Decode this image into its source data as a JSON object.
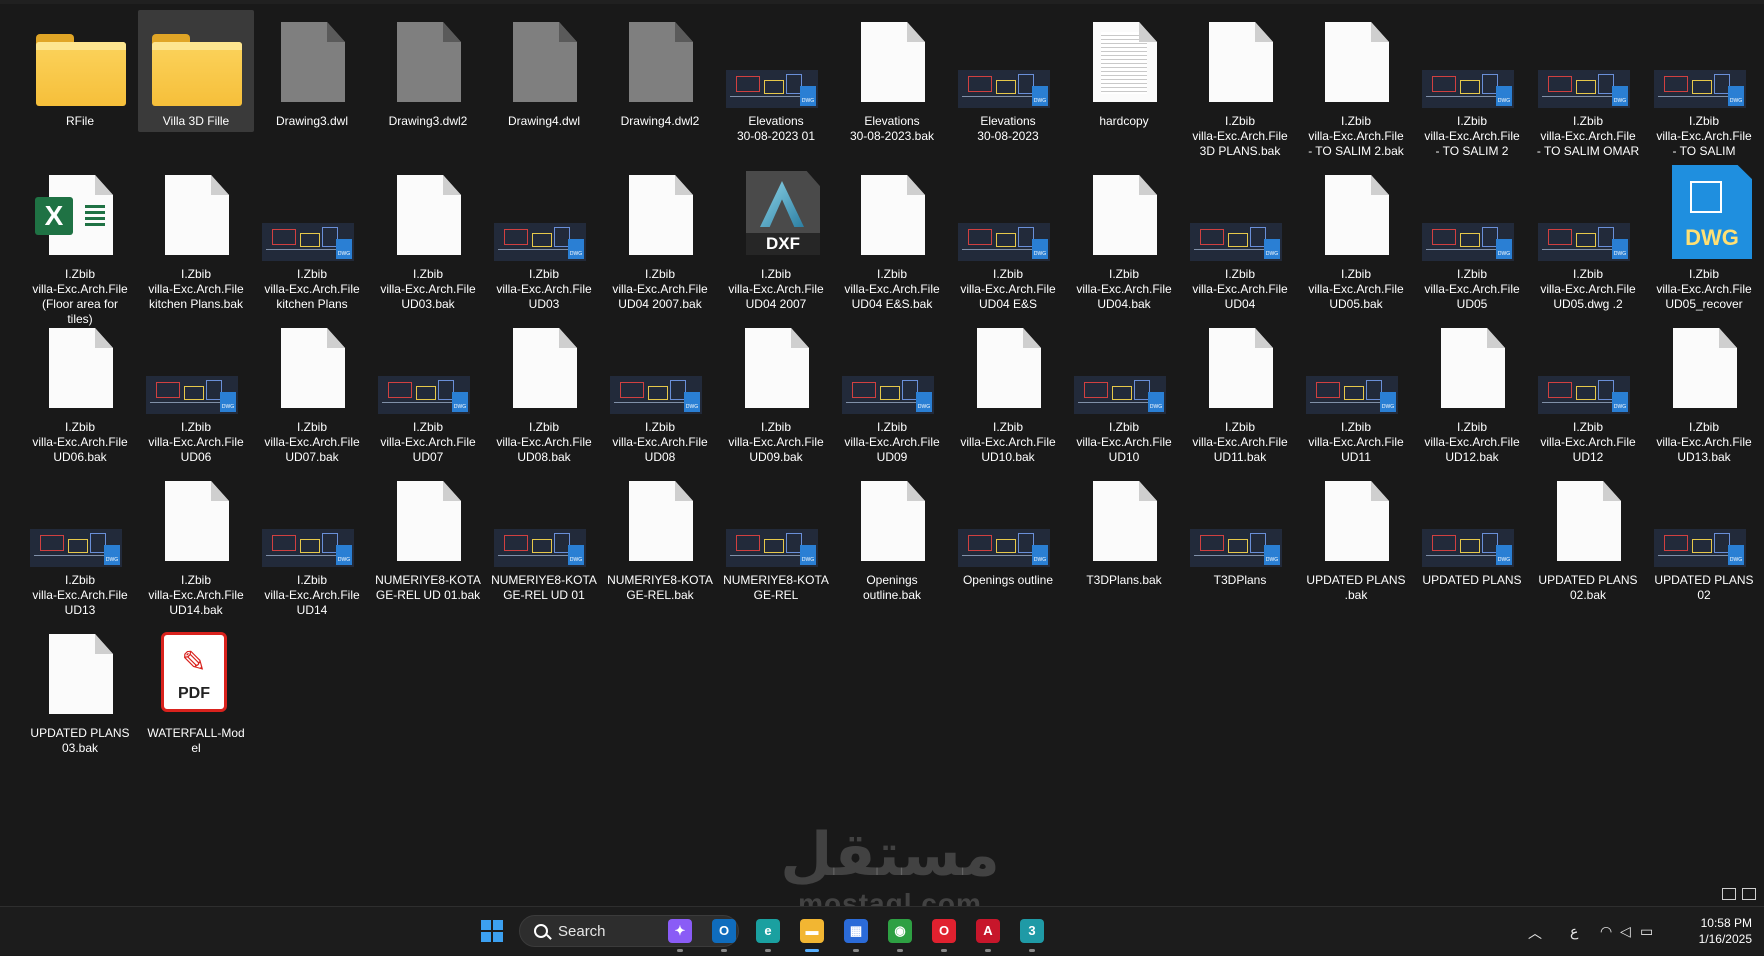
{
  "files": [
    {
      "name": "RFile",
      "icon": "folder-icon",
      "kind": "folder"
    },
    {
      "name": "Villa 3D Fille",
      "icon": "folder-icon",
      "kind": "folder",
      "selected": true
    },
    {
      "name": "Drawing3.dwl",
      "icon": "gray-file-icon",
      "kind": "gray"
    },
    {
      "name": "Drawing3.dwl2",
      "icon": "gray-file-icon",
      "kind": "gray"
    },
    {
      "name": "Drawing4.dwl",
      "icon": "gray-file-icon",
      "kind": "gray"
    },
    {
      "name": "Drawing4.dwl2",
      "icon": "gray-file-icon",
      "kind": "gray"
    },
    {
      "name": "Elevations\n30-08-2023 01",
      "icon": "dwg-preview-icon",
      "kind": "cad"
    },
    {
      "name": "Elevations\n30-08-2023.bak",
      "icon": "blank-file-icon",
      "kind": "blank"
    },
    {
      "name": "Elevations\n30-08-2023",
      "icon": "dwg-preview-icon",
      "kind": "cad"
    },
    {
      "name": "hardcopy",
      "icon": "text-file-icon",
      "kind": "text"
    },
    {
      "name": "I.Zbib\nvilla-Exc.Arch.File\n3D PLANS.bak",
      "icon": "blank-file-icon",
      "kind": "blank"
    },
    {
      "name": "I.Zbib\nvilla-Exc.Arch.File\n- TO SALIM 2.bak",
      "icon": "blank-file-icon",
      "kind": "blank"
    },
    {
      "name": "I.Zbib\nvilla-Exc.Arch.File\n- TO SALIM 2",
      "icon": "dwg-preview-icon",
      "kind": "cad"
    },
    {
      "name": "I.Zbib\nvilla-Exc.Arch.File\n- TO SALIM OMAR",
      "icon": "dwg-preview-icon",
      "kind": "cad"
    },
    {
      "name": "I.Zbib\nvilla-Exc.Arch.File\n- TO SALIM",
      "icon": "dwg-preview-icon",
      "kind": "cad"
    },
    {
      "name": "I.Zbib\nvilla-Exc.Arch.File\n(Floor area for\ntiles)",
      "icon": "excel-file-icon",
      "kind": "excel"
    },
    {
      "name": "I.Zbib\nvilla-Exc.Arch.File\nkitchen Plans.bak",
      "icon": "blank-file-icon",
      "kind": "blank"
    },
    {
      "name": "I.Zbib\nvilla-Exc.Arch.File\nkitchen Plans",
      "icon": "dwg-preview-icon",
      "kind": "cad"
    },
    {
      "name": "I.Zbib\nvilla-Exc.Arch.File\nUD03.bak",
      "icon": "blank-file-icon",
      "kind": "blank"
    },
    {
      "name": "I.Zbib\nvilla-Exc.Arch.File\nUD03",
      "icon": "dwg-preview-icon",
      "kind": "cad"
    },
    {
      "name": "I.Zbib\nvilla-Exc.Arch.File\nUD04 2007.bak",
      "icon": "blank-file-icon",
      "kind": "blank"
    },
    {
      "name": "I.Zbib\nvilla-Exc.Arch.File\nUD04 2007",
      "icon": "dxf-file-icon",
      "kind": "dxf",
      "badge": "DXF"
    },
    {
      "name": "I.Zbib\nvilla-Exc.Arch.File\nUD04 E&S.bak",
      "icon": "blank-file-icon",
      "kind": "blank"
    },
    {
      "name": "I.Zbib\nvilla-Exc.Arch.File\nUD04 E&S",
      "icon": "dwg-preview-icon",
      "kind": "cad"
    },
    {
      "name": "I.Zbib\nvilla-Exc.Arch.File\nUD04.bak",
      "icon": "blank-file-icon",
      "kind": "blank"
    },
    {
      "name": "I.Zbib\nvilla-Exc.Arch.File\nUD04",
      "icon": "dwg-preview-icon",
      "kind": "cad"
    },
    {
      "name": "I.Zbib\nvilla-Exc.Arch.File\nUD05.bak",
      "icon": "blank-file-icon",
      "kind": "blank"
    },
    {
      "name": "I.Zbib\nvilla-Exc.Arch.File\nUD05",
      "icon": "dwg-preview-icon",
      "kind": "cad"
    },
    {
      "name": "I.Zbib\nvilla-Exc.Arch.File\nUD05.dwg .2",
      "icon": "dwg-preview-icon",
      "kind": "cad"
    },
    {
      "name": "I.Zbib\nvilla-Exc.Arch.File\nUD05_recover",
      "icon": "dwg-file-icon",
      "kind": "dwg",
      "badge": "DWG"
    },
    {
      "name": "I.Zbib\nvilla-Exc.Arch.File\nUD06.bak",
      "icon": "blank-file-icon",
      "kind": "blank"
    },
    {
      "name": "I.Zbib\nvilla-Exc.Arch.File\nUD06",
      "icon": "dwg-preview-icon",
      "kind": "cad"
    },
    {
      "name": "I.Zbib\nvilla-Exc.Arch.File\nUD07.bak",
      "icon": "blank-file-icon",
      "kind": "blank"
    },
    {
      "name": "I.Zbib\nvilla-Exc.Arch.File\nUD07",
      "icon": "dwg-preview-icon",
      "kind": "cad"
    },
    {
      "name": "I.Zbib\nvilla-Exc.Arch.File\nUD08.bak",
      "icon": "blank-file-icon",
      "kind": "blank"
    },
    {
      "name": "I.Zbib\nvilla-Exc.Arch.File\nUD08",
      "icon": "dwg-preview-icon",
      "kind": "cad"
    },
    {
      "name": "I.Zbib\nvilla-Exc.Arch.File\nUD09.bak",
      "icon": "blank-file-icon",
      "kind": "blank"
    },
    {
      "name": "I.Zbib\nvilla-Exc.Arch.File\nUD09",
      "icon": "dwg-preview-icon",
      "kind": "cad"
    },
    {
      "name": "I.Zbib\nvilla-Exc.Arch.File\nUD10.bak",
      "icon": "blank-file-icon",
      "kind": "blank"
    },
    {
      "name": "I.Zbib\nvilla-Exc.Arch.File\nUD10",
      "icon": "dwg-preview-icon",
      "kind": "cad"
    },
    {
      "name": "I.Zbib\nvilla-Exc.Arch.File\nUD11.bak",
      "icon": "blank-file-icon",
      "kind": "blank"
    },
    {
      "name": "I.Zbib\nvilla-Exc.Arch.File\nUD11",
      "icon": "dwg-preview-icon",
      "kind": "cad"
    },
    {
      "name": "I.Zbib\nvilla-Exc.Arch.File\nUD12.bak",
      "icon": "blank-file-icon",
      "kind": "blank"
    },
    {
      "name": "I.Zbib\nvilla-Exc.Arch.File\nUD12",
      "icon": "dwg-preview-icon",
      "kind": "cad"
    },
    {
      "name": "I.Zbib\nvilla-Exc.Arch.File\nUD13.bak",
      "icon": "blank-file-icon",
      "kind": "blank"
    },
    {
      "name": "I.Zbib\nvilla-Exc.Arch.File\nUD13",
      "icon": "dwg-preview-icon",
      "kind": "cad"
    },
    {
      "name": "I.Zbib\nvilla-Exc.Arch.File\nUD14.bak",
      "icon": "blank-file-icon",
      "kind": "blank"
    },
    {
      "name": "I.Zbib\nvilla-Exc.Arch.File\nUD14",
      "icon": "dwg-preview-icon",
      "kind": "cad"
    },
    {
      "name": "NUMERIYE8-KOTA\nGE-REL UD 01.bak",
      "icon": "blank-file-icon",
      "kind": "blank"
    },
    {
      "name": "NUMERIYE8-KOTA\nGE-REL UD 01",
      "icon": "dwg-preview-icon",
      "kind": "cad"
    },
    {
      "name": "NUMERIYE8-KOTA\nGE-REL.bak",
      "icon": "blank-file-icon",
      "kind": "blank"
    },
    {
      "name": "NUMERIYE8-KOTA\nGE-REL",
      "icon": "dwg-preview-icon",
      "kind": "cad"
    },
    {
      "name": "Openings\noutline.bak",
      "icon": "blank-file-icon",
      "kind": "blank"
    },
    {
      "name": "Openings outline",
      "icon": "dwg-preview-icon",
      "kind": "cad"
    },
    {
      "name": "T3DPlans.bak",
      "icon": "blank-file-icon",
      "kind": "blank"
    },
    {
      "name": "T3DPlans",
      "icon": "dwg-preview-icon",
      "kind": "cad"
    },
    {
      "name": "UPDATED PLANS\n.bak",
      "icon": "blank-file-icon",
      "kind": "blank"
    },
    {
      "name": "UPDATED PLANS",
      "icon": "dwg-preview-icon",
      "kind": "cad"
    },
    {
      "name": "UPDATED PLANS\n02.bak",
      "icon": "blank-file-icon",
      "kind": "blank"
    },
    {
      "name": "UPDATED PLANS\n02",
      "icon": "dwg-preview-icon",
      "kind": "cad"
    },
    {
      "name": "UPDATED PLANS\n03.bak",
      "icon": "blank-file-icon",
      "kind": "blank"
    },
    {
      "name": "WATERFALL-Mod\nel",
      "icon": "pdf-file-icon",
      "kind": "pdf",
      "badge": "PDF"
    }
  ],
  "cad_badge": "DWG",
  "watermark": {
    "arabic": "مستقل",
    "latin": "mostaql.com"
  },
  "taskbar": {
    "search_placeholder": "Search",
    "apps": [
      {
        "icon": "copilot-icon",
        "glyph": "✦",
        "color": "#8a5cf6"
      },
      {
        "icon": "outlook-icon",
        "glyph": "O",
        "color": "#0f6cbd"
      },
      {
        "icon": "edge-icon",
        "glyph": "e",
        "color": "#1aa0a0"
      },
      {
        "icon": "file-explorer-icon",
        "glyph": "▬",
        "color": "#f2b632",
        "active": true
      },
      {
        "icon": "microsoft-store-icon",
        "glyph": "▦",
        "color": "#2b6bd8"
      },
      {
        "icon": "chrome-icon",
        "glyph": "◉",
        "color": "#2ea043"
      },
      {
        "icon": "opera-icon",
        "glyph": "O",
        "color": "#e0212f"
      },
      {
        "icon": "autocad-icon",
        "glyph": "A",
        "color": "#c7162b"
      },
      {
        "icon": "3ds-max-icon",
        "glyph": "3",
        "color": "#1f9aa6"
      }
    ],
    "language": "ع",
    "time": "10:58 PM",
    "date": "1/16/2025"
  }
}
